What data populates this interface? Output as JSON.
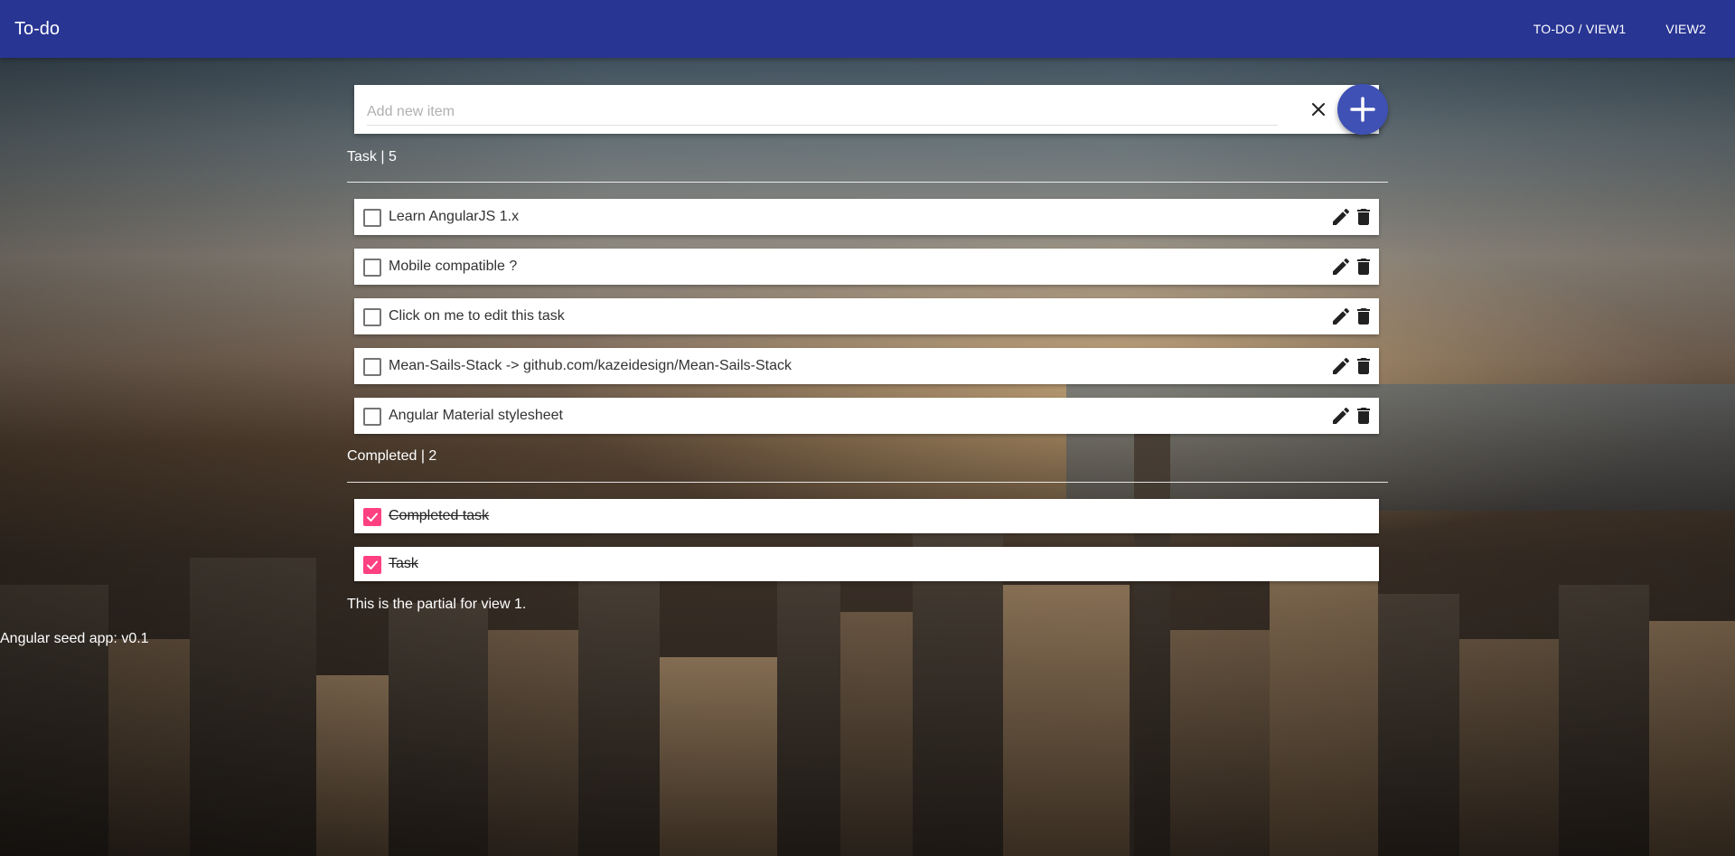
{
  "app": {
    "title": "To-do",
    "nav": [
      {
        "label": "TO-DO / VIEW1"
      },
      {
        "label": "VIEW2"
      }
    ]
  },
  "add_item": {
    "placeholder": "Add new item",
    "value": ""
  },
  "tasks": {
    "header": "Task | 5",
    "items": [
      {
        "label": "Learn AngularJS 1.x",
        "checked": false
      },
      {
        "label": "Mobile compatible ?",
        "checked": false
      },
      {
        "label": "Click on me to edit this task",
        "checked": false
      },
      {
        "label": "Mean-Sails-Stack -> github.com/kazeidesign/Mean-Sails-Stack",
        "checked": false
      },
      {
        "label": "Angular Material stylesheet",
        "checked": false
      }
    ]
  },
  "completed": {
    "header": "Completed | 2",
    "items": [
      {
        "label": "Completed task",
        "checked": true
      },
      {
        "label": "Task",
        "checked": true
      }
    ]
  },
  "partial_text": "This is the partial for view 1.",
  "footer_text": "Angular seed app: v0.1",
  "colors": {
    "toolbar": "#283593",
    "fab": "#3f51b5",
    "checkbox_checked": "#ff4081"
  },
  "icons": {
    "clear": "close-icon",
    "add": "plus-icon",
    "edit": "pencil-icon",
    "delete": "trash-icon",
    "check": "check-icon"
  }
}
